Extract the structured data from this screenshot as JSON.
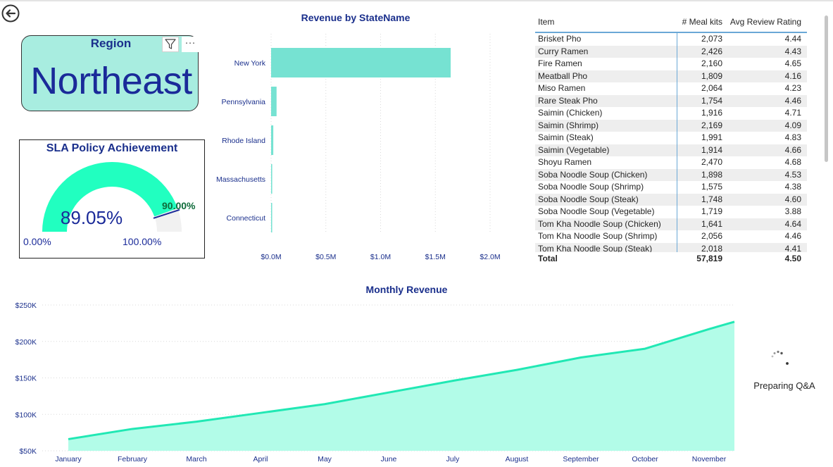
{
  "region_card": {
    "title": "Region",
    "value": "Northeast"
  },
  "gauge": {
    "title": "SLA Policy Achievement",
    "value_label": "89.05%",
    "value": 89.05,
    "target_label": "90.00%",
    "target": 90.0,
    "min_label": "0.00%",
    "max_label": "100.00%",
    "fill_color": "#21ffc0",
    "track_color": "#f1f1f1",
    "target_color": "#1a2a99"
  },
  "bar_chart": {
    "title": "Revenue by StateName",
    "chart_data": {
      "type": "bar",
      "orientation": "horizontal",
      "categories": [
        "New York",
        "Pennsylvania",
        "Rhode Island",
        "Massachusetts",
        "Connecticut"
      ],
      "values": [
        1.64,
        0.05,
        0.02,
        0.01,
        0.007
      ],
      "unit": "$M",
      "xlim": [
        0,
        2.0
      ],
      "x_ticks": [
        "$0.0M",
        "$0.5M",
        "$1.0M",
        "$1.5M",
        "$2.0M"
      ],
      "grid": true,
      "bar_color": "#76e2d2"
    }
  },
  "table": {
    "headers": {
      "item": "Item",
      "kits": "# Meal kits",
      "rating": "Avg Review Rating"
    },
    "rows": [
      {
        "item": "Brisket Pho",
        "kits": "2,073",
        "rating": "4.44"
      },
      {
        "item": "Curry Ramen",
        "kits": "2,426",
        "rating": "4.43"
      },
      {
        "item": "Fire Ramen",
        "kits": "2,160",
        "rating": "4.65"
      },
      {
        "item": "Meatball Pho",
        "kits": "1,809",
        "rating": "4.16"
      },
      {
        "item": "Miso Ramen",
        "kits": "2,064",
        "rating": "4.23"
      },
      {
        "item": "Rare Steak Pho",
        "kits": "1,754",
        "rating": "4.46"
      },
      {
        "item": "Saimin (Chicken)",
        "kits": "1,916",
        "rating": "4.71"
      },
      {
        "item": "Saimin (Shrimp)",
        "kits": "2,169",
        "rating": "4.09"
      },
      {
        "item": "Saimin (Steak)",
        "kits": "1,991",
        "rating": "4.83"
      },
      {
        "item": "Saimin (Vegetable)",
        "kits": "1,914",
        "rating": "4.66"
      },
      {
        "item": "Shoyu Ramen",
        "kits": "2,470",
        "rating": "4.68"
      },
      {
        "item": "Soba Noodle Soup (Chicken)",
        "kits": "1,898",
        "rating": "4.53"
      },
      {
        "item": "Soba Noodle Soup (Shrimp)",
        "kits": "1,575",
        "rating": "4.38"
      },
      {
        "item": "Soba Noodle Soup (Steak)",
        "kits": "1,748",
        "rating": "4.60"
      },
      {
        "item": "Soba Noodle Soup (Vegetable)",
        "kits": "1,719",
        "rating": "3.88"
      },
      {
        "item": "Tom Kha Noodle Soup (Chicken)",
        "kits": "1,641",
        "rating": "4.64"
      },
      {
        "item": "Tom Kha Noodle Soup (Shrimp)",
        "kits": "2,056",
        "rating": "4.46"
      },
      {
        "item": "Tom Kha Noodle Soup (Steak)",
        "kits": "2,018",
        "rating": "4.41"
      }
    ],
    "total": {
      "label": "Total",
      "kits": "57,819",
      "rating": "4.50"
    }
  },
  "line_chart": {
    "title": "Monthly Revenue",
    "chart_data": {
      "type": "area",
      "x": [
        "January",
        "February",
        "March",
        "April",
        "May",
        "June",
        "July",
        "August",
        "September",
        "October",
        "November"
      ],
      "values": [
        66000,
        80000,
        90000,
        102000,
        114000,
        130000,
        146000,
        161000,
        178000,
        190000,
        217000,
        227000
      ],
      "unit": "$",
      "ylim": [
        50000,
        250000
      ],
      "y_ticks": [
        "$250K",
        "$200K",
        "$150K",
        "$100K",
        "$50K"
      ],
      "grid": true,
      "line_color": "#21e8b4",
      "fill_color": "#b2fce8"
    }
  },
  "qa": {
    "label": "Preparing Q&A"
  },
  "icons": {
    "back": "back-arrow-icon",
    "filter": "filter-icon",
    "more": "more-options-icon",
    "spinner": "loading-spinner-icon"
  }
}
